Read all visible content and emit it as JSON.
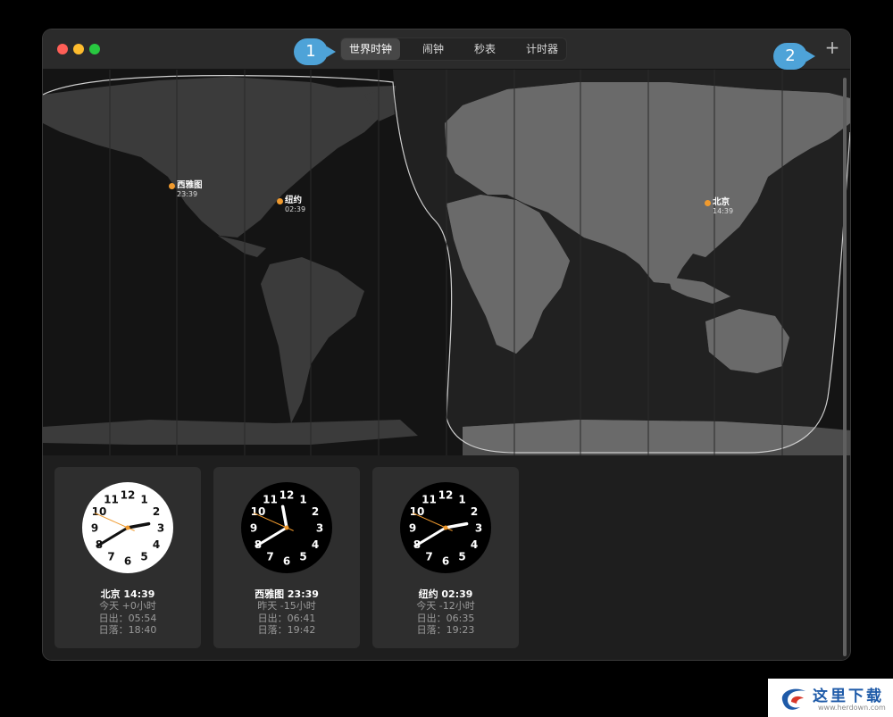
{
  "window": {
    "tabs": [
      {
        "label": "世界时钟",
        "active": true
      },
      {
        "label": "闹钟",
        "active": false
      },
      {
        "label": "秒表",
        "active": false
      },
      {
        "label": "计时器",
        "active": false
      }
    ],
    "add_label": "+"
  },
  "map": {
    "cities": [
      {
        "name": "西雅图",
        "time": "23:39"
      },
      {
        "name": "纽约",
        "time": "02:39"
      },
      {
        "name": "北京",
        "time": "14:39"
      }
    ]
  },
  "clocks": [
    {
      "title": "北京 14:39",
      "day": "今天 +0小时",
      "sunrise": "日出：05:54",
      "sunset": "日落：18:40",
      "face": "light",
      "hour": 14,
      "minute": 39,
      "second": 49
    },
    {
      "title": "西雅图 23:39",
      "day": "昨天 -15小时",
      "sunrise": "日出：06:41",
      "sunset": "日落：19:42",
      "face": "dark",
      "hour": 23,
      "minute": 39,
      "second": 49
    },
    {
      "title": "纽约 02:39",
      "day": "今天 -12小时",
      "sunrise": "日出：06:35",
      "sunset": "日落：19:23",
      "face": "dark",
      "hour": 2,
      "minute": 39,
      "second": 49
    }
  ],
  "annotations": [
    "1",
    "2"
  ],
  "watermark": {
    "title": "这里下载",
    "url": "www.herdown.com"
  },
  "colors": {
    "accent": "#f09a2e",
    "callout": "#4ea3d8"
  }
}
